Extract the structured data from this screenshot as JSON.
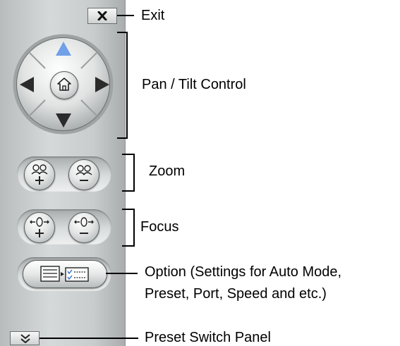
{
  "callouts": {
    "exit": "Exit",
    "pan_tilt": "Pan / Tilt Control",
    "zoom": "Zoom",
    "focus": "Focus",
    "option_line1": "Option (Settings for Auto Mode,",
    "option_line2": "Preset, Port, Speed and etc.)",
    "preset_switch": "Preset Switch Panel"
  },
  "colors": {
    "up_arrow": "#6fa0e8",
    "arrow": "#2b2b2b",
    "panel": "#c8cccc"
  },
  "icons": {
    "exit": "close-icon",
    "up": "arrow-up-icon",
    "down": "arrow-down-icon",
    "left": "arrow-left-icon",
    "right": "arrow-right-icon",
    "home": "home-icon",
    "zoom_in": "zoom-in-icon",
    "zoom_out": "zoom-out-icon",
    "focus_near": "focus-plus-icon",
    "focus_far": "focus-minus-icon",
    "option": "settings-icon",
    "preset_switch": "chevron-double-down-icon"
  }
}
